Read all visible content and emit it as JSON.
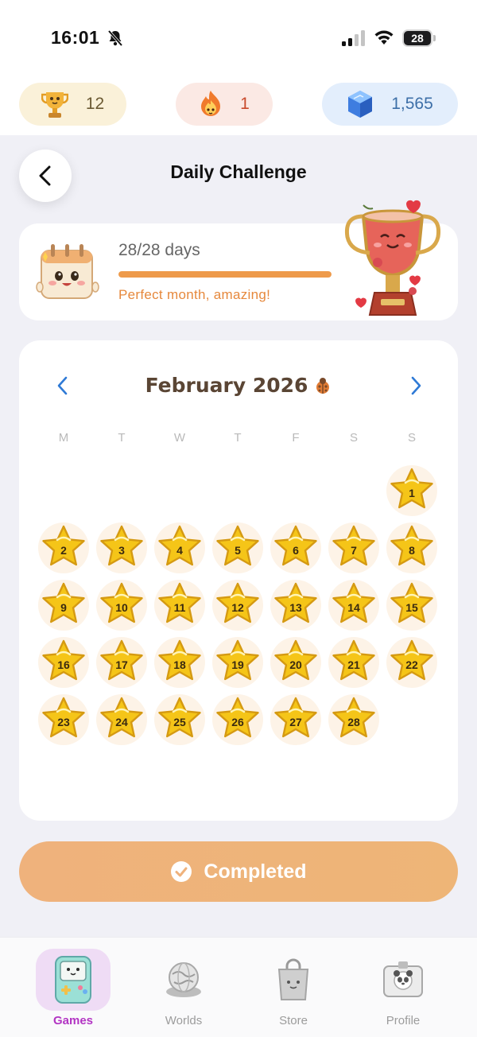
{
  "status_bar": {
    "time": "16:01",
    "battery": "28"
  },
  "stats": {
    "trophies": "12",
    "streak": "1",
    "gems": "1,565"
  },
  "header": {
    "title": "Daily Challenge"
  },
  "progress": {
    "text": "28/28 days",
    "completed_days": 28,
    "total_days": 28,
    "message": "Perfect month, amazing!",
    "bar_color": "#ee9a4a"
  },
  "calendar": {
    "month": "February 2026",
    "weekdays": [
      "M",
      "T",
      "W",
      "T",
      "F",
      "S",
      "S"
    ],
    "first_weekday_index": 6,
    "days": [
      "1",
      "2",
      "3",
      "4",
      "5",
      "6",
      "7",
      "8",
      "9",
      "10",
      "11",
      "12",
      "13",
      "14",
      "15",
      "16",
      "17",
      "18",
      "19",
      "20",
      "21",
      "22",
      "23",
      "24",
      "25",
      "26",
      "27",
      "28"
    ],
    "completed_days": 28
  },
  "action": {
    "label": "Completed",
    "color": "#efb27c"
  },
  "tabs": [
    {
      "label": "Games",
      "icon": "game-console-icon",
      "active": true
    },
    {
      "label": "Worlds",
      "icon": "globe-icon",
      "active": false
    },
    {
      "label": "Store",
      "icon": "shopping-bag-icon",
      "active": false
    },
    {
      "label": "Profile",
      "icon": "id-badge-icon",
      "active": false
    }
  ],
  "colors": {
    "accent": "#ee9a4a",
    "active_tab": "#b234c3",
    "star": "#f5c518"
  }
}
